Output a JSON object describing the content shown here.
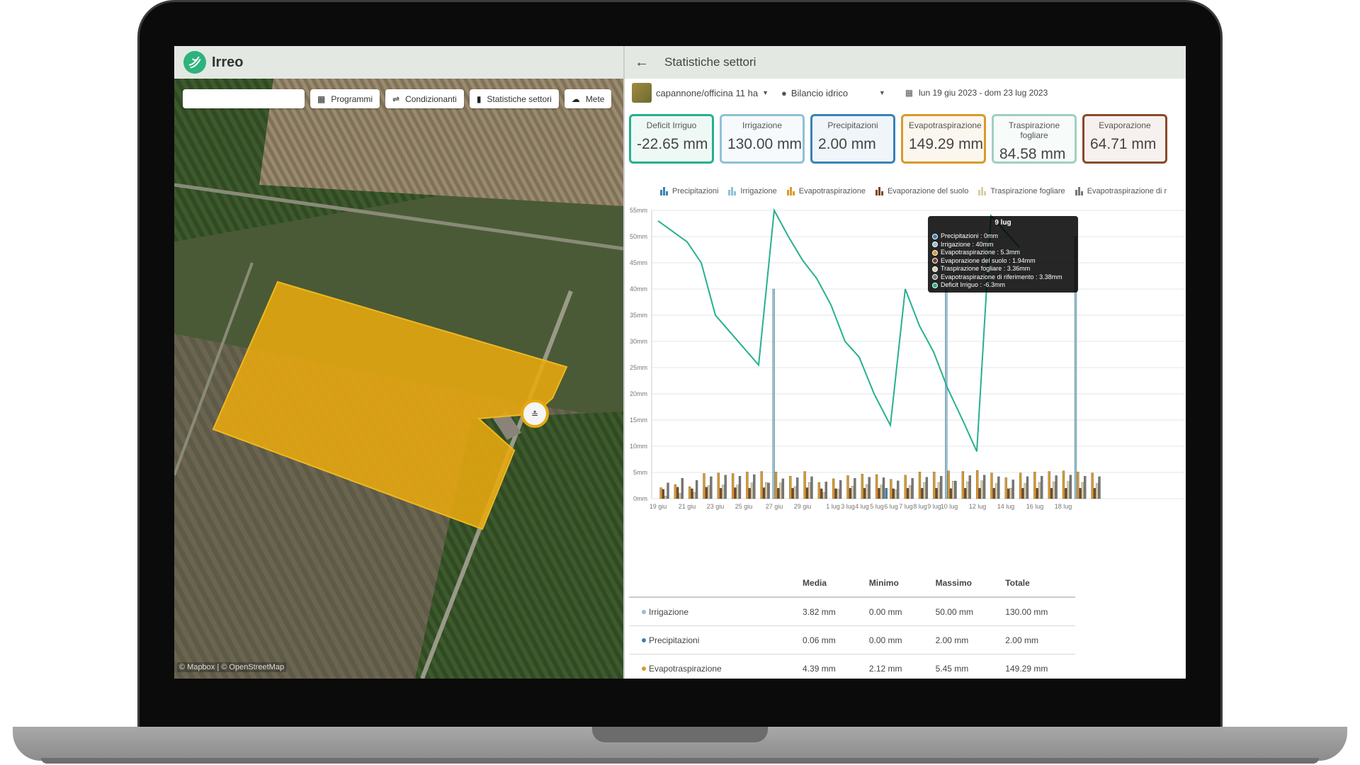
{
  "app": {
    "name": "Irreo"
  },
  "toolbar": {
    "search_placeholder": "",
    "buttons": [
      {
        "label": "Programmi",
        "icon": "calendar-icon"
      },
      {
        "label": "Condizionanti",
        "icon": "sliders-icon"
      },
      {
        "label": "Statistiche settori",
        "icon": "bar-chart-icon"
      },
      {
        "label": "Mete",
        "icon": "cloud-icon"
      }
    ]
  },
  "map": {
    "attribution": "© Mapbox | © OpenStreetMap"
  },
  "stats": {
    "title": "Statistiche settori",
    "sector": "capannone/officina 11 ha",
    "metric": "Bilancio idrico",
    "date_range": "lun 19 giu 2023 - dom 23 lug 2023",
    "cards": [
      {
        "label": "Deficit Irriguo",
        "value": "-22.65 mm",
        "color": "#26b08f"
      },
      {
        "label": "Irrigazione",
        "value": "130.00 mm",
        "color": "#8fc1d6"
      },
      {
        "label": "Precipitazioni",
        "value": "2.00 mm",
        "color": "#3a82b6"
      },
      {
        "label": "Evapotraspirazione",
        "value": "149.29 mm",
        "color": "#d99a2b"
      },
      {
        "label": "Traspirazione fogliare",
        "value": "84.58 mm",
        "color": "#9fd0c0"
      },
      {
        "label": "Evaporazione",
        "value": "64.71 mm",
        "color": "#8a4a2a"
      }
    ],
    "legend": [
      {
        "label": "Precipitazioni",
        "color": "#3a82b6"
      },
      {
        "label": "Irrigazione",
        "color": "#8fc1d6"
      },
      {
        "label": "Evapotraspirazione",
        "color": "#d99a2b"
      },
      {
        "label": "Evaporazione del suolo",
        "color": "#7a4626"
      },
      {
        "label": "Traspirazione fogliare",
        "color": "#d8cfa8"
      },
      {
        "label": "Evapotraspirazione di r",
        "color": "#777777"
      }
    ],
    "tooltip": {
      "title": "9 lug",
      "rows": [
        {
          "text": "Precipitazioni : 0mm",
          "color": "#3a82b6"
        },
        {
          "text": "Irrigazione : 40mm",
          "color": "#8fc1d6"
        },
        {
          "text": "Evapotraspirazione : 5.3mm",
          "color": "#d99a2b"
        },
        {
          "text": "Evaporazione del suolo : 1.94mm",
          "color": "#7a4626"
        },
        {
          "text": "Traspirazione fogliare : 3.36mm",
          "color": "#d8cfa8"
        },
        {
          "text": "Evapotraspirazione di riferimento : 3.38mm",
          "color": "#777777"
        },
        {
          "text": "Deficit Irriguo : -6.3mm",
          "color": "#26b08f"
        }
      ]
    },
    "table": {
      "headers": [
        "",
        "Media",
        "Minimo",
        "Massimo",
        "Totale"
      ],
      "rows": [
        {
          "name": "Irrigazione",
          "color": "#8fc1d6",
          "media": "3.82 mm",
          "minimo": "0.00 mm",
          "massimo": "50.00 mm",
          "totale": "130.00 mm"
        },
        {
          "name": "Precipitazioni",
          "color": "#3a82b6",
          "media": "0.06 mm",
          "minimo": "0.00 mm",
          "massimo": "2.00 mm",
          "totale": "2.00 mm"
        },
        {
          "name": "Evapotraspirazione",
          "color": "#d99a2b",
          "media": "4.39 mm",
          "minimo": "2.12 mm",
          "massimo": "5.45 mm",
          "totale": "149.29 mm"
        }
      ]
    }
  },
  "chart_data": {
    "type": "bar",
    "y_ticks": [
      "0mm",
      "5mm",
      "10mm",
      "15mm",
      "20mm",
      "25mm",
      "30mm",
      "35mm",
      "40mm",
      "45mm",
      "50mm",
      "55mm"
    ],
    "ylim": [
      0,
      55
    ],
    "x_labels": [
      "19 giu",
      "21 giu",
      "23 giu",
      "25 giu",
      "27 giu",
      "29 giu",
      "1 lug",
      "3 lug",
      "4 lug",
      "5 lug",
      "6 lug",
      "7 lug",
      "8 lug",
      "9 lug",
      "10 lug",
      "12 lug",
      "14 lug",
      "16 lug",
      "18 lug"
    ],
    "dates": [
      "19 giu",
      "20 giu",
      "21 giu",
      "22 giu",
      "23 giu",
      "24 giu",
      "25 giu",
      "26 giu",
      "27 giu",
      "28 giu",
      "29 giu",
      "30 giu",
      "1 lug",
      "2 lug",
      "3 lug",
      "4 lug",
      "5 lug",
      "6 lug",
      "7 lug",
      "8 lug",
      "9 lug",
      "10 lug",
      "11 lug",
      "12 lug",
      "13 lug",
      "14 lug",
      "15 lug",
      "16 lug",
      "17 lug",
      "18 lug",
      "19 lug"
    ],
    "series": [
      {
        "name": "Precipitazioni",
        "color": "#3a82b6",
        "values": [
          0,
          0,
          0,
          0,
          0,
          0,
          0,
          0,
          0,
          0,
          0,
          0,
          0,
          0,
          0,
          0,
          2,
          0,
          0,
          0,
          0,
          0,
          0,
          0,
          0,
          0,
          0,
          0,
          0,
          0,
          0
        ]
      },
      {
        "name": "Irrigazione",
        "color": "#8fc1d6",
        "values": [
          0,
          0,
          0,
          0,
          0,
          0,
          0,
          0,
          40,
          0,
          0,
          0,
          0,
          0,
          0,
          0,
          0,
          0,
          0,
          0,
          40,
          0,
          0,
          0,
          0,
          0,
          0,
          0,
          0,
          50,
          0
        ]
      },
      {
        "name": "Evapotraspirazione",
        "color": "#d99a2b",
        "values": [
          2.1,
          2.7,
          2.3,
          4.8,
          4.9,
          4.8,
          5.1,
          5.2,
          5.1,
          4.3,
          5.2,
          3.1,
          3.8,
          4.4,
          4.7,
          4.6,
          3.7,
          4.5,
          5.1,
          5.1,
          5.3,
          5.2,
          5.4,
          4.9,
          4.0,
          4.9,
          5.1,
          5.2,
          5.3,
          5.1,
          4.9
        ]
      },
      {
        "name": "Evaporazione del suolo",
        "color": "#7a4626",
        "values": [
          1.8,
          2.2,
          1.9,
          2.2,
          2.0,
          2.1,
          2.0,
          2.1,
          2.0,
          2.0,
          2.1,
          1.9,
          1.9,
          2.0,
          2.0,
          2.0,
          1.9,
          2.0,
          2.0,
          2.0,
          1.94,
          2.0,
          2.0,
          2.0,
          1.9,
          2.0,
          2.0,
          2.0,
          2.0,
          2.0,
          2.0
        ]
      },
      {
        "name": "Traspirazione fogliare",
        "color": "#d8cfa8",
        "values": [
          0.5,
          1.0,
          1.2,
          2.5,
          2.6,
          2.6,
          3.0,
          3.1,
          3.0,
          2.3,
          3.1,
          1.2,
          1.8,
          2.4,
          2.7,
          2.6,
          1.7,
          2.5,
          3.1,
          3.1,
          3.36,
          3.2,
          3.4,
          2.9,
          2.0,
          2.9,
          3.1,
          3.2,
          3.3,
          3.1,
          2.9
        ]
      },
      {
        "name": "Evapotraspirazione di riferimento",
        "color": "#777777",
        "values": [
          3.0,
          3.9,
          3.5,
          4.2,
          4.5,
          4.3,
          4.6,
          3.0,
          3.8,
          4.0,
          4.2,
          3.2,
          3.5,
          3.9,
          4.1,
          4.0,
          3.4,
          3.9,
          4.1,
          4.3,
          3.38,
          4.4,
          4.5,
          4.2,
          3.6,
          4.2,
          4.3,
          4.4,
          4.5,
          4.3,
          4.2
        ]
      },
      {
        "name": "Deficit Irriguo",
        "color": "#26b08f",
        "type": "line",
        "values": [
          53,
          49,
          45,
          35,
          25.5,
          null,
          null,
          null,
          55,
          50,
          45.5,
          42,
          37,
          30,
          27,
          20,
          14,
          40,
          33,
          28,
          21,
          15,
          9,
          54,
          48
        ]
      }
    ]
  }
}
